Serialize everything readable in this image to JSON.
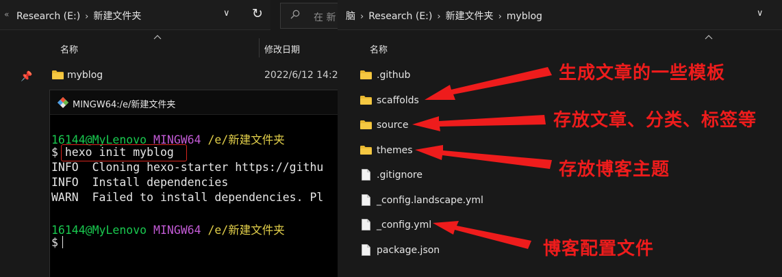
{
  "left": {
    "address": {
      "drive": "Research (E:)",
      "folder": "新建文件夹"
    },
    "search_placeholder": "在 新",
    "columns": {
      "name": "名称",
      "date": "修改日期"
    },
    "row": {
      "name": "myblog",
      "date": "2022/6/12 14:2"
    }
  },
  "terminal": {
    "title": "MINGW64:/e/新建文件夹",
    "prompt_user": "16144@MyLenovo",
    "prompt_env": "MINGW64",
    "prompt_path": "/e/新建文件夹",
    "dollar": "$",
    "command": "hexo init myblog",
    "lines": [
      "INFO  Cloning hexo-starter https://githu",
      "INFO  Install dependencies",
      "WARN  Failed to install dependencies. Pl"
    ]
  },
  "right": {
    "address": {
      "root": "脑",
      "drive": "Research (E:)",
      "folder": "新建文件夹",
      "sub": "myblog"
    },
    "column_name": "名称",
    "items": [
      {
        "name": ".github",
        "type": "folder"
      },
      {
        "name": "scaffolds",
        "type": "folder"
      },
      {
        "name": "source",
        "type": "folder"
      },
      {
        "name": "themes",
        "type": "folder"
      },
      {
        "name": ".gitignore",
        "type": "file"
      },
      {
        "name": "_config.landscape.yml",
        "type": "file"
      },
      {
        "name": "_config.yml",
        "type": "file"
      },
      {
        "name": "package.json",
        "type": "file"
      }
    ]
  },
  "annotations": {
    "scaffolds": "生成文章的一些模板",
    "source": "存放文章、分类、标签等",
    "themes": "存放博客主题",
    "config": "博客配置文件"
  },
  "colors": {
    "annotation": "#ee1c1c",
    "folder": "#e8b730",
    "prompt_green": "#19c94f",
    "prompt_magenta": "#c25ad5",
    "prompt_yellow": "#e2cf4a"
  }
}
